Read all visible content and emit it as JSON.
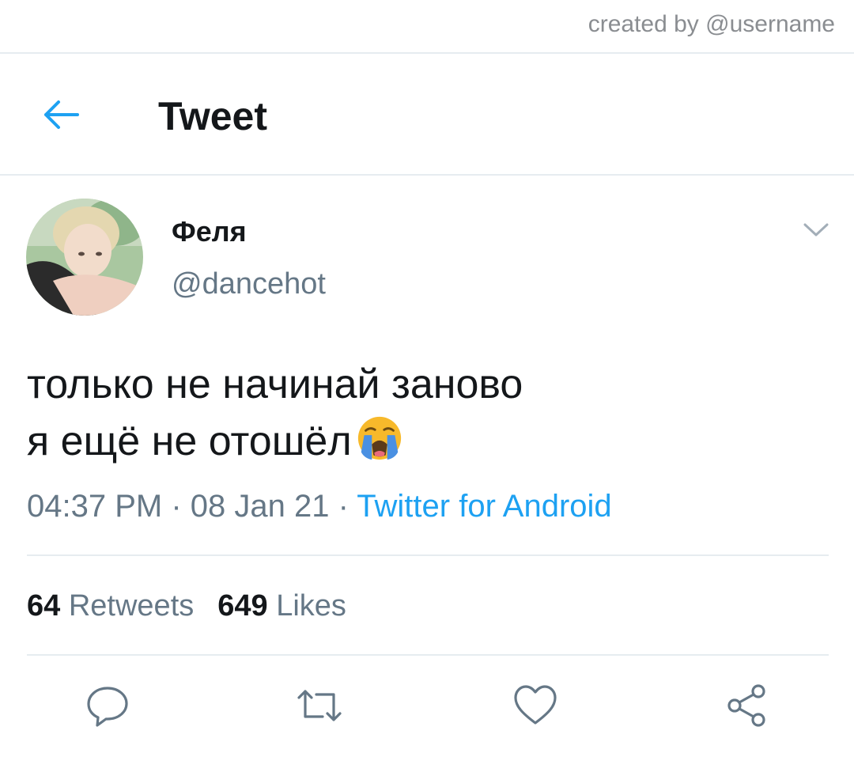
{
  "credit": "created by @username",
  "header": {
    "title": "Tweet",
    "back_icon": "arrow-left-icon"
  },
  "author": {
    "display_name": "Феля",
    "handle": "@dancehot",
    "avatar": "user-photo-avatar",
    "menu_icon": "chevron-down-icon"
  },
  "tweet": {
    "line1": "только не начинай заново",
    "line2": "я ещё не отошёл",
    "emoji": "loudly-crying-face-emoji",
    "time": "04:37 PM",
    "date": "08 Jan 21",
    "separator": " · ",
    "source": "Twitter for Android"
  },
  "stats": {
    "retweets_count": "64",
    "retweets_label": "Retweets",
    "likes_count": "649",
    "likes_label": "Likes"
  },
  "actions": [
    "reply-icon",
    "retweet-icon",
    "like-icon",
    "share-icon"
  ],
  "colors": {
    "accent": "#1da1f2",
    "text": "#14171a",
    "muted": "#657786",
    "divider": "#e6ecf0"
  }
}
